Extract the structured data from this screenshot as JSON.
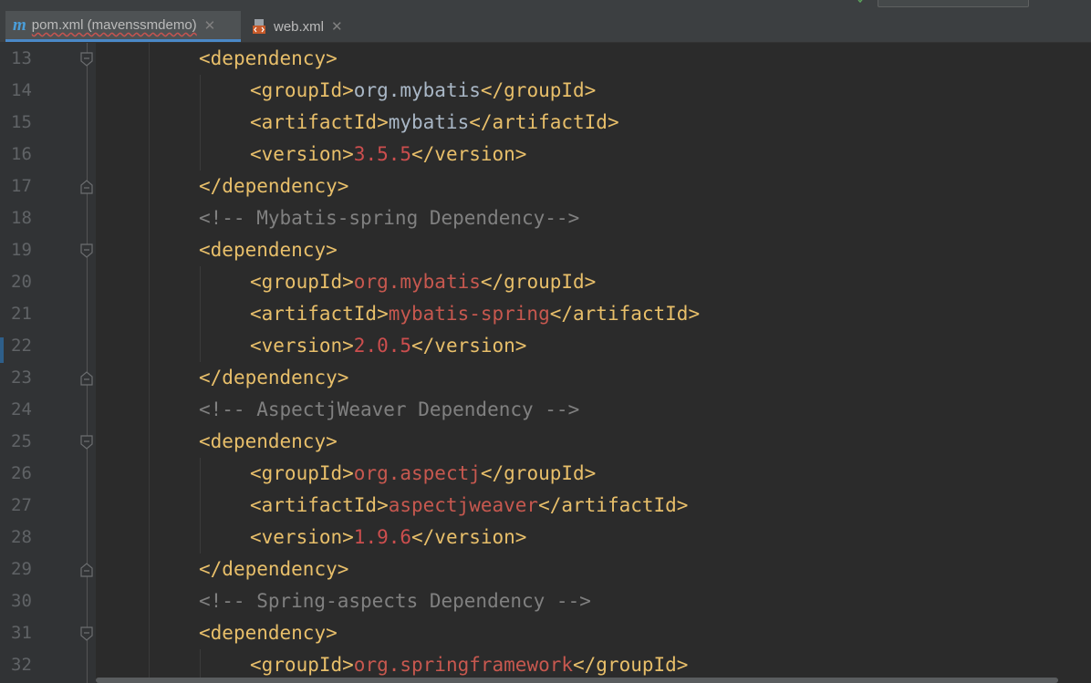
{
  "tabs": [
    {
      "label": "pom.xml (mavenssmdemo)",
      "icon": "maven-m-icon",
      "active": true
    },
    {
      "label": "web.xml",
      "icon": "xml-file-icon",
      "active": false
    }
  ],
  "close_glyph": "✕",
  "maven_glyph": "m",
  "lines": [
    {
      "n": "13",
      "lt": "<",
      "name": "dependency",
      "gt": ">",
      "fold": "open",
      "indent": 1
    },
    {
      "n": "14",
      "open": "<groupId>",
      "value": "org.mybatis",
      "close": "</groupId>",
      "vclass": "val",
      "indent": 2
    },
    {
      "n": "15",
      "open": "<artifactId>",
      "value": "mybatis",
      "close": "</artifactId>",
      "vclass": "val",
      "indent": 2
    },
    {
      "n": "16",
      "open": "<version>",
      "value": "3.5.5",
      "close": "</version>",
      "vclass": "num",
      "indent": 2
    },
    {
      "n": "17",
      "lt": "</",
      "name": "dependency",
      "gt": ">",
      "fold": "close",
      "indent": 1
    },
    {
      "n": "18",
      "comment": "<!-- Mybatis-spring Dependency-->",
      "indent": 1
    },
    {
      "n": "19",
      "lt": "<",
      "name": "dependency",
      "gt": ">",
      "fold": "open",
      "indent": 1
    },
    {
      "n": "20",
      "open": "<groupId>",
      "value": "org.mybatis",
      "close": "</groupId>",
      "vclass": "red",
      "indent": 2
    },
    {
      "n": "21",
      "open": "<artifactId>",
      "value": "mybatis-spring",
      "close": "</artifactId>",
      "vclass": "red",
      "indent": 2
    },
    {
      "n": "22",
      "open": "<version>",
      "value": "2.0.5",
      "close": "</version>",
      "vclass": "num",
      "indent": 2
    },
    {
      "n": "23",
      "lt": "</",
      "name": "dependency",
      "gt": ">",
      "fold": "close",
      "indent": 1
    },
    {
      "n": "24",
      "comment": "<!-- AspectjWeaver Dependency -->",
      "indent": 1
    },
    {
      "n": "25",
      "lt": "<",
      "name": "dependency",
      "gt": ">",
      "fold": "open",
      "indent": 1
    },
    {
      "n": "26",
      "open": "<groupId>",
      "value": "org.aspectj",
      "close": "</groupId>",
      "vclass": "red",
      "indent": 2
    },
    {
      "n": "27",
      "open": "<artifactId>",
      "value": "aspectjweaver",
      "close": "</artifactId>",
      "vclass": "red",
      "indent": 2
    },
    {
      "n": "28",
      "open": "<version>",
      "value": "1.9.6",
      "close": "</version>",
      "vclass": "num",
      "indent": 2
    },
    {
      "n": "29",
      "lt": "</",
      "name": "dependency",
      "gt": ">",
      "fold": "close",
      "indent": 1
    },
    {
      "n": "30",
      "comment": "<!-- Spring-aspects Dependency -->",
      "indent": 1
    },
    {
      "n": "31",
      "lt": "<",
      "name": "dependency",
      "gt": ">",
      "fold": "open",
      "indent": 1
    },
    {
      "n": "32",
      "open": "<groupId>",
      "value": "org.springframework",
      "close": "</groupId>",
      "vclass": "red",
      "indent": 2
    }
  ],
  "colors": {
    "tag": "#e8bf6a",
    "text": "#a9b7c6",
    "number": "#cc4e4e",
    "comment": "#808080",
    "line_number": "#606366",
    "active_tab_accent": "#4a88c7"
  }
}
